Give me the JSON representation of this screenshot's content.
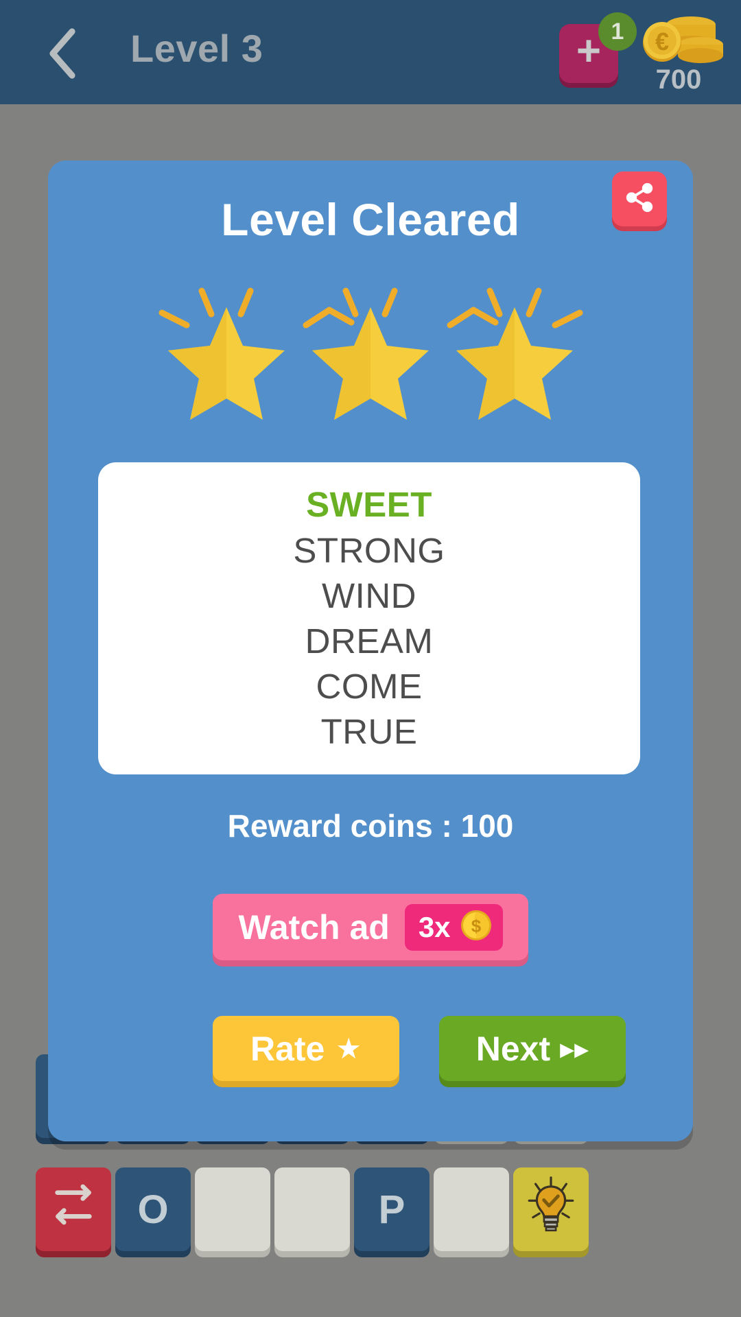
{
  "header": {
    "back_icon": "chevron-left-icon",
    "title": "Level 3",
    "plus_icon": "plus-icon",
    "plus_badge_count": "1",
    "coins_icon": "coin-stack-euro-icon",
    "coins_count": "700",
    "bg_color": "#2b4f6e"
  },
  "dialog": {
    "title": "Level Cleared",
    "share_icon": "share-icon",
    "bg_color": "#5390cb",
    "stars": {
      "count": 3,
      "icon": "star-sparkle-icon",
      "color": "#f7cf3f"
    },
    "words": [
      {
        "text": "SWEET",
        "found": true
      },
      {
        "text": "STRONG",
        "found": false
      },
      {
        "text": "WIND",
        "found": false
      },
      {
        "text": "DREAM",
        "found": false
      },
      {
        "text": "COME",
        "found": false
      },
      {
        "text": "TRUE",
        "found": false
      }
    ],
    "found_color": "#6ab023",
    "word_color": "#4d4d4d",
    "reward_text": "Reward coins : 100",
    "watch_ad": {
      "label": "Watch ad",
      "multiplier": "3x",
      "coin_icon": "gold-coin-dollar-icon",
      "bg_color": "#f9729d",
      "badge_color": "#f02a7b"
    },
    "rate_button": {
      "label": "Rate",
      "icon": "star-icon",
      "glyph": "★",
      "bg_color": "#fdc638"
    },
    "next_button": {
      "label": "Next",
      "icon": "fast-forward-icon",
      "glyph": "▸▸",
      "bg_color": "#6aa924"
    }
  },
  "board": {
    "top_row_tiles": [
      {
        "letter": "",
        "type": "blue"
      },
      {
        "letter": "",
        "type": "blue"
      },
      {
        "letter": "",
        "type": "blue"
      },
      {
        "letter": "",
        "type": "blue"
      },
      {
        "letter": "",
        "type": "blue"
      },
      {
        "letter": "",
        "type": "empty"
      },
      {
        "letter": "",
        "type": "empty"
      }
    ],
    "bottom_row_tiles": [
      {
        "letter": "",
        "type": "red",
        "icon": "shuffle-icon"
      },
      {
        "letter": "O",
        "type": "blue",
        "icon": ""
      },
      {
        "letter": "",
        "type": "empty",
        "icon": ""
      },
      {
        "letter": "",
        "type": "empty",
        "icon": ""
      },
      {
        "letter": "P",
        "type": "blue",
        "icon": ""
      },
      {
        "letter": "",
        "type": "empty",
        "icon": ""
      },
      {
        "letter": "",
        "type": "yellow",
        "icon": "lightbulb-hint-icon"
      }
    ]
  }
}
